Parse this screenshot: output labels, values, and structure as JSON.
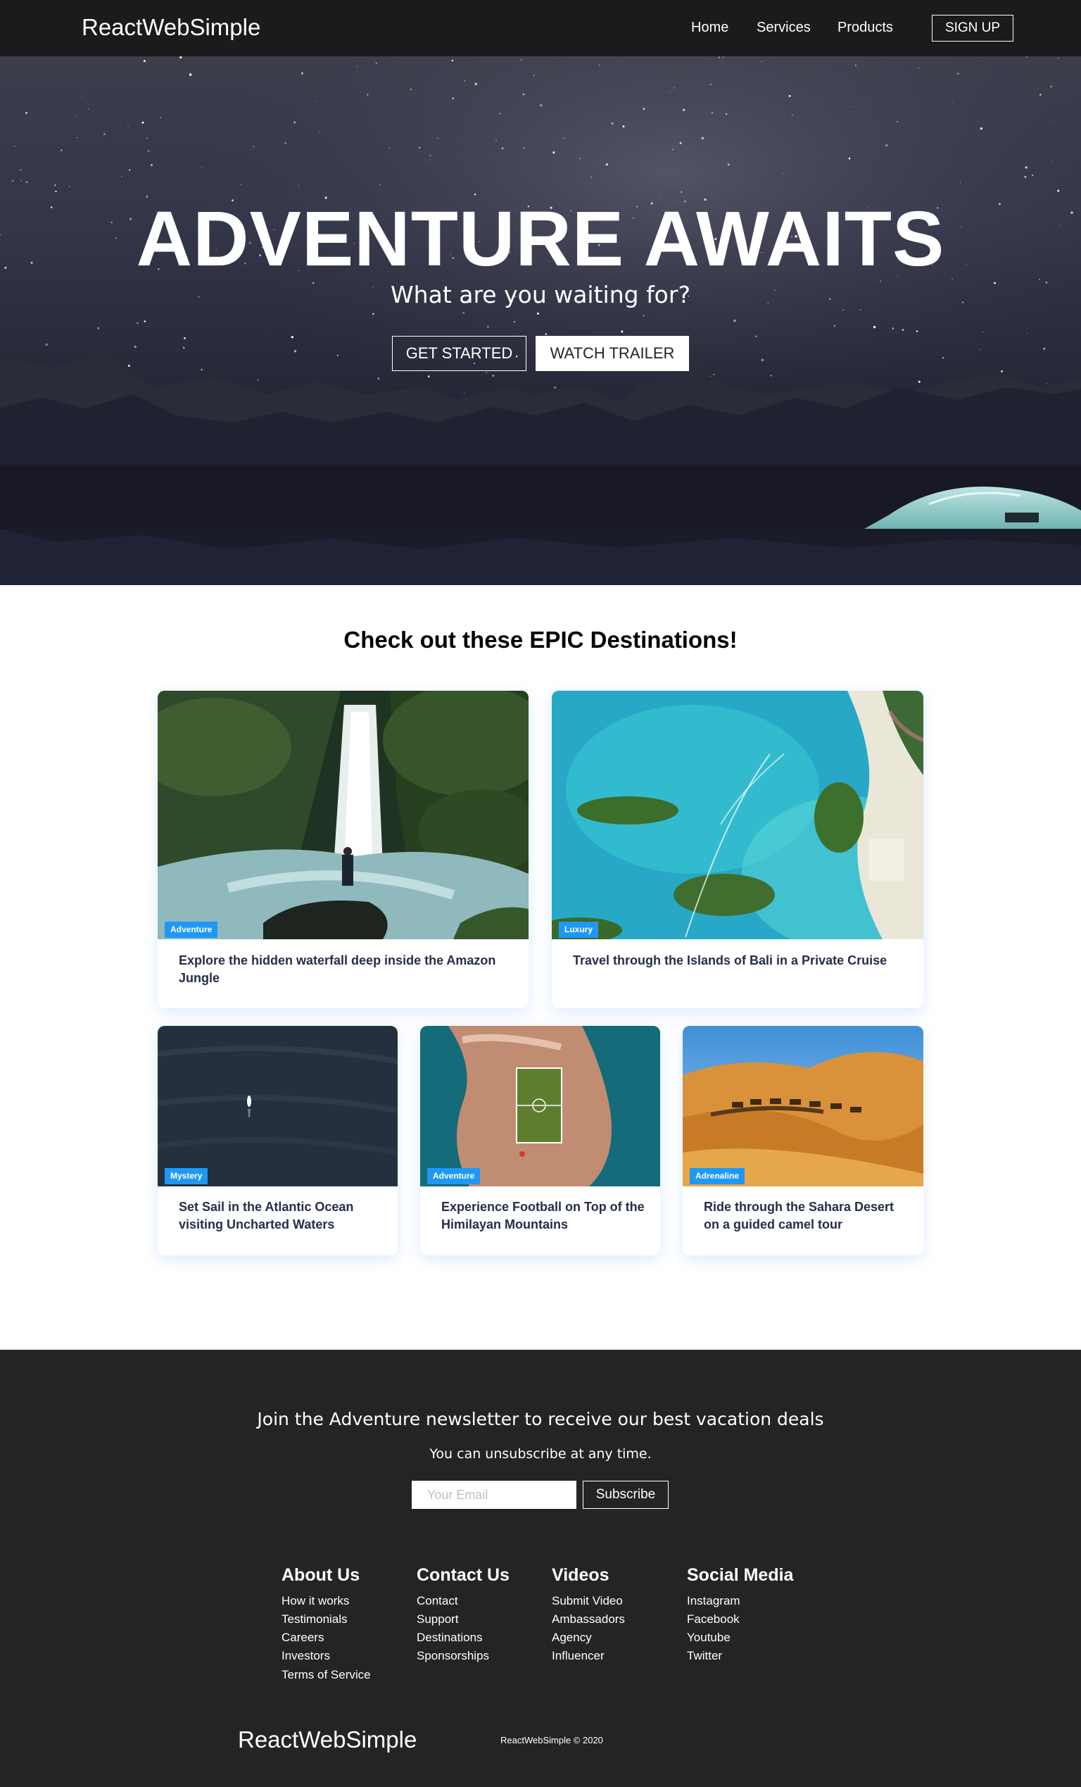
{
  "nav": {
    "logo": "ReactWebSimple",
    "links": [
      "Home",
      "Services",
      "Products"
    ],
    "signup": "SIGN UP"
  },
  "hero": {
    "title": "ADVENTURE AWAITS",
    "subtitle": "What are you waiting for?",
    "primary_button": "GET STARTED",
    "secondary_button": "WATCH TRAILER"
  },
  "destinations": {
    "heading": "Check out these EPIC Destinations!",
    "cards": [
      {
        "tag": "Adventure",
        "text": "Explore the hidden waterfall deep inside the Amazon Jungle",
        "image": "waterfall"
      },
      {
        "tag": "Luxury",
        "text": "Travel through the Islands of Bali in a Private Cruise",
        "image": "islands"
      },
      {
        "tag": "Mystery",
        "text": "Set Sail in the Atlantic Ocean visiting Uncharted Waters",
        "image": "ocean-boat"
      },
      {
        "tag": "Adventure",
        "text": "Experience Football on Top of the Himilayan Mountains",
        "image": "island-football-field"
      },
      {
        "tag": "Adrenaline",
        "text": "Ride through the Sahara Desert on a guided camel tour",
        "image": "desert-camels"
      }
    ]
  },
  "footer": {
    "newsletter_heading": "Join the Adventure newsletter to receive our best vacation deals",
    "newsletter_text": "You can unsubscribe at any time.",
    "email_placeholder": "Your Email",
    "subscribe": "Subscribe",
    "columns": [
      {
        "title": "About Us",
        "links": [
          "How it works",
          "Testimonials",
          "Careers",
          "Investors",
          "Terms of Service"
        ]
      },
      {
        "title": "Contact Us",
        "links": [
          "Contact",
          "Support",
          "Destinations",
          "Sponsorships"
        ]
      },
      {
        "title": "Videos",
        "links": [
          "Submit Video",
          "Ambassadors",
          "Agency",
          "Influencer"
        ]
      },
      {
        "title": "Social Media",
        "links": [
          "Instagram",
          "Facebook",
          "Youtube",
          "Twitter"
        ]
      }
    ],
    "logo": "ReactWebSimple",
    "copyright": "ReactWebSimple © 2020"
  },
  "colors": {
    "nav_bg": "#1c1b1b",
    "footer_bg": "#242424",
    "tag_bg": "#1f98f4",
    "card_text": "#252e48"
  }
}
